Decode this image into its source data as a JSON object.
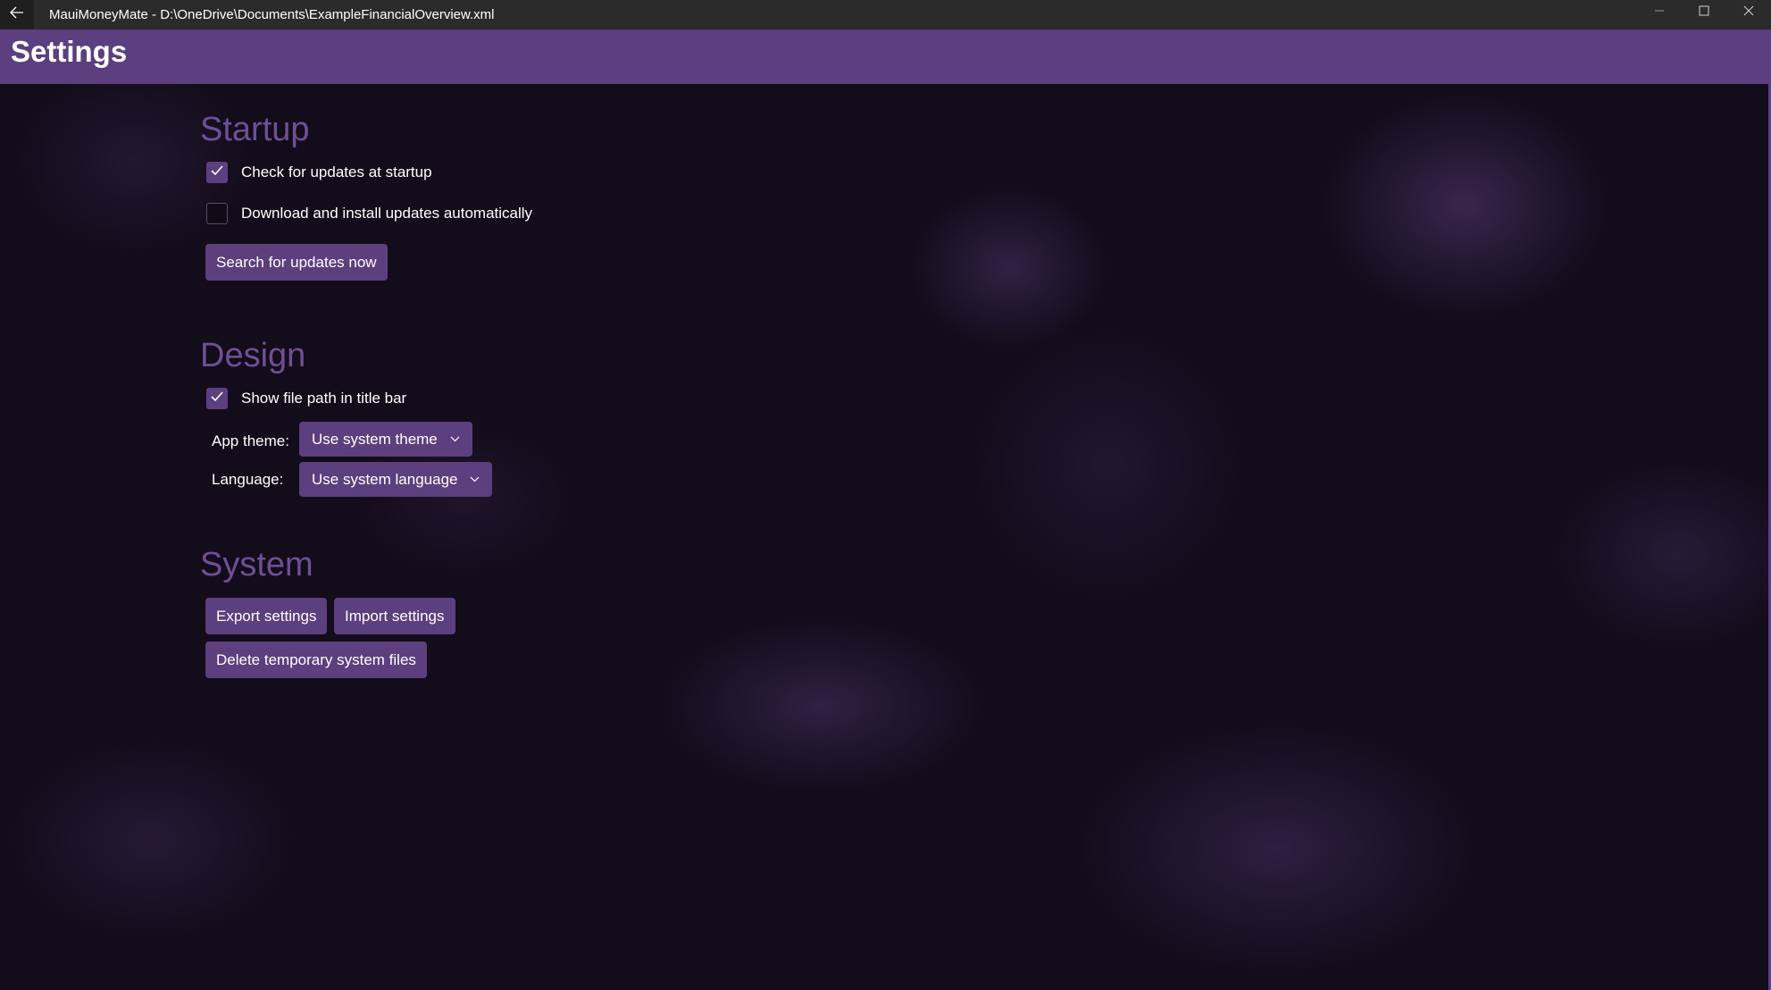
{
  "window": {
    "title": "MauiMoneyMate - D:\\OneDrive\\Documents\\ExampleFinancialOverview.xml",
    "back_icon": "back-arrow-icon",
    "minimize_icon": "minimize-icon",
    "maximize_icon": "maximize-icon",
    "close_icon": "close-icon"
  },
  "header": {
    "title": "Settings",
    "accent_color": "#5c3f7e"
  },
  "startup": {
    "title": "Startup",
    "check_updates": {
      "label": "Check for updates at startup",
      "checked": true
    },
    "auto_install": {
      "label": "Download and install updates automatically",
      "checked": false
    },
    "search_button": "Search for updates now"
  },
  "design": {
    "title": "Design",
    "show_path": {
      "label": "Show file path in title bar",
      "checked": true
    },
    "app_theme": {
      "label": "App theme:",
      "value": "Use system theme"
    },
    "language": {
      "label": "Language:",
      "value": "Use system language"
    }
  },
  "system": {
    "title": "System",
    "export_button": "Export settings",
    "import_button": "Import settings",
    "delete_button": "Delete temporary system files"
  }
}
